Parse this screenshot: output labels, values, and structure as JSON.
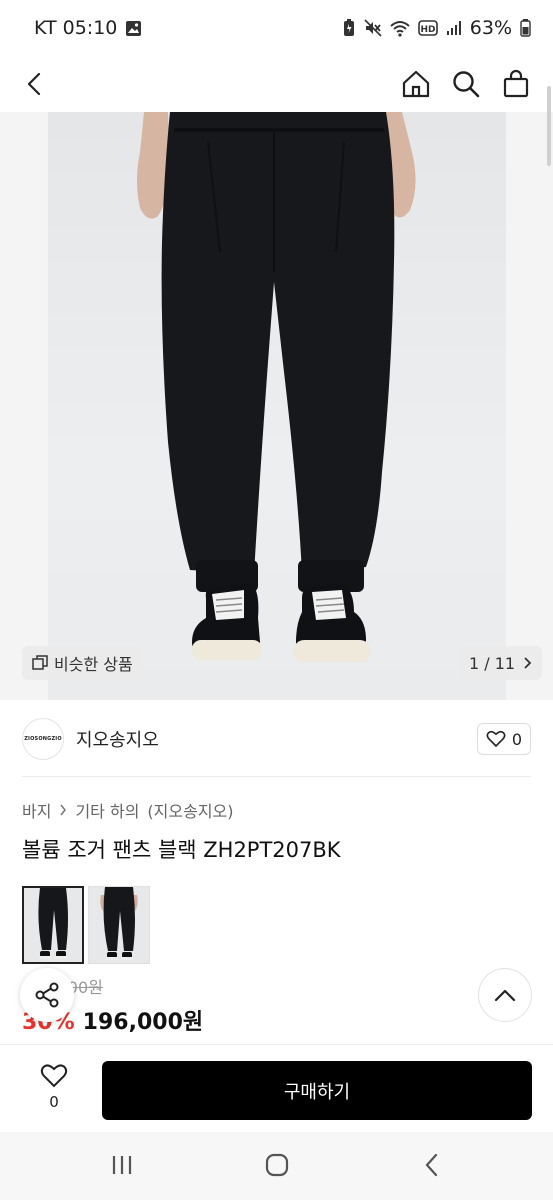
{
  "status_bar": {
    "carrier_time": "KT 05:10",
    "battery": "63%",
    "icons": [
      "gallery-icon",
      "battery-saver-icon",
      "mute-icon",
      "wifi-icon",
      "hd-icon",
      "signal-icon",
      "battery-icon"
    ]
  },
  "top_nav": {
    "icons": [
      "back-icon",
      "home-icon",
      "search-icon",
      "shopping-bag-icon"
    ]
  },
  "hero": {
    "similar_label": "비슷한 상품",
    "page_indicator": "1 / 11",
    "image": "black-jogger-pants-model"
  },
  "store": {
    "logo_text": "ZIOSONGZIO",
    "name": "지오송지오",
    "like_count": "0"
  },
  "product": {
    "breadcrumb": [
      "바지",
      "기타 하의",
      "(지오송지오)"
    ],
    "title": "볼륨 조거 팬츠 블랙 ZH2PT207BK",
    "original_price": "280,000원",
    "discount": "30%",
    "price": "196,000원",
    "thumbnails": [
      "front-view",
      "back-view"
    ]
  },
  "bottom_bar": {
    "wish_count": "0",
    "buy_label": "구매하기"
  },
  "system_nav": {
    "icons": [
      "recent-apps-icon",
      "home-circle-icon",
      "back-chevron-icon"
    ]
  },
  "colors": {
    "accent_red": "#e8342e",
    "buy_button": "#000000"
  }
}
